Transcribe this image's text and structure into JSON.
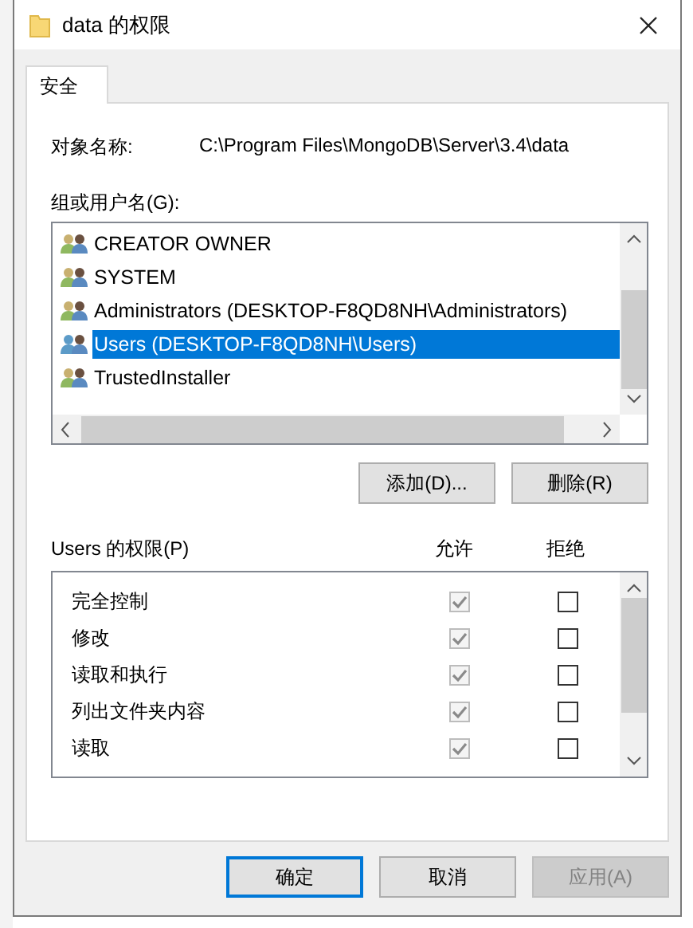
{
  "window": {
    "title": "data 的权限"
  },
  "tabs": [
    {
      "label": "安全",
      "selected": true
    }
  ],
  "object_name": {
    "label": "对象名称:",
    "value": "C:\\Program Files\\MongoDB\\Server\\3.4\\data"
  },
  "groups": {
    "label": "组或用户名(G):",
    "items": [
      {
        "name": "CREATOR OWNER",
        "selected": false
      },
      {
        "name": "SYSTEM",
        "selected": false
      },
      {
        "name": "Administrators (DESKTOP-F8QD8NH\\Administrators)",
        "selected": false
      },
      {
        "name": "Users (DESKTOP-F8QD8NH\\Users)",
        "selected": true
      },
      {
        "name": "TrustedInstaller",
        "selected": false
      }
    ]
  },
  "group_buttons": [
    {
      "label": "添加(D)..."
    },
    {
      "label": "删除(R)"
    }
  ],
  "permissions": {
    "label": "Users 的权限(P)",
    "allow_header": "允许",
    "deny_header": "拒绝",
    "rows": [
      {
        "name": "完全控制",
        "allow": true,
        "allow_disabled": true,
        "deny": false
      },
      {
        "name": "修改",
        "allow": true,
        "allow_disabled": true,
        "deny": false
      },
      {
        "name": "读取和执行",
        "allow": true,
        "allow_disabled": true,
        "deny": false
      },
      {
        "name": "列出文件夹内容",
        "allow": true,
        "allow_disabled": true,
        "deny": false
      },
      {
        "name": "读取",
        "allow": true,
        "allow_disabled": true,
        "deny": false
      }
    ]
  },
  "buttons": [
    {
      "label": "确定",
      "default": true,
      "disabled": false
    },
    {
      "label": "取消",
      "default": false,
      "disabled": false
    },
    {
      "label": "应用(A)",
      "default": false,
      "disabled": true
    }
  ]
}
